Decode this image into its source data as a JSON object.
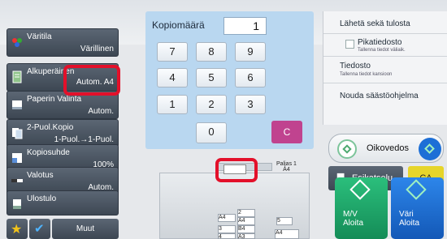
{
  "left_panel": {
    "items": [
      {
        "label": "Väritila",
        "value": "Värillinen",
        "icon": "color-mode-icon"
      },
      {
        "label": "Alkuperäinen",
        "value": "Autom.  A4",
        "icon": "original-doc-icon"
      },
      {
        "label": "Paperin Valinta",
        "value": "Autom.",
        "icon": "paper-select-icon"
      },
      {
        "label": "2-Puol.Kopio",
        "value": "1-Puol.→1-Puol.",
        "icon": "duplex-icon"
      },
      {
        "label": "Kopiosuhde",
        "value": "100%",
        "icon": "ratio-icon"
      },
      {
        "label": "Valotus",
        "value": "Autom.",
        "icon": "exposure-icon"
      },
      {
        "label": "Ulostulo",
        "value": "",
        "icon": "output-icon"
      }
    ],
    "more_label": "Muut"
  },
  "keypad": {
    "count_label": "Kopiomäärä",
    "count_value": "1",
    "keys": [
      "7",
      "8",
      "9",
      "4",
      "5",
      "6",
      "1",
      "2",
      "3",
      "0"
    ],
    "clear_label": "C"
  },
  "right_panel": {
    "send_label": "Lähetä sekä tulosta",
    "quick_file_title": "Pikatiedosto",
    "quick_file_sub": "Tallenna tiedot väliaik.",
    "file_title": "Tiedosto",
    "file_sub": "Tallenna tiedot kansioon",
    "eco_label": "Nouda säästöohjelma",
    "straight_label": "Oikovedos",
    "preview_label": "Esikatselu",
    "ca_label": "CA",
    "mono_start": "M/V\nAloita",
    "color_start": "Väri\nAloita"
  },
  "preview": {
    "original_label": "Paljas 1",
    "original_size": "A4",
    "tray_labels": [
      {
        "n": "1",
        "size": "A4"
      },
      {
        "n": "2",
        "size": "A4"
      },
      {
        "n": "3",
        "size": "B4"
      },
      {
        "n": "4",
        "size": "A3"
      },
      {
        "n": "5",
        "size": ""
      }
    ],
    "output_size": "A4"
  },
  "colors": {
    "accent_magenta": "#c0438f",
    "accent_yellow": "#e6d52a",
    "start_green": "#1fa36a",
    "start_blue": "#1d6fd6",
    "highlight_red": "#e3102a"
  }
}
